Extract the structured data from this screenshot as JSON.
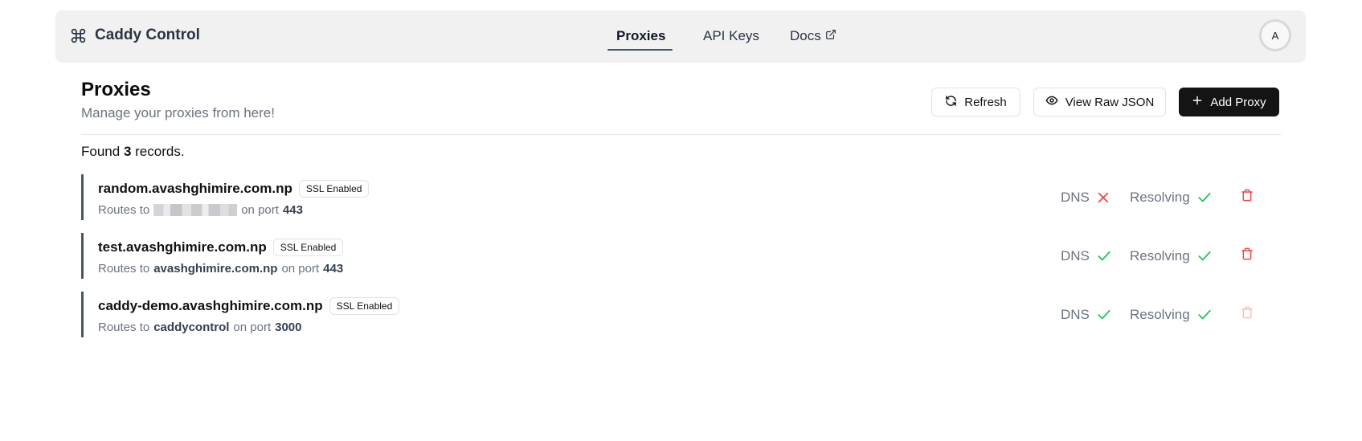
{
  "header": {
    "brand_icon": "command-icon",
    "brand_name": "Caddy Control",
    "tabs": [
      {
        "label": "Proxies",
        "active": true
      },
      {
        "label": "API Keys",
        "active": false
      },
      {
        "label": "Docs",
        "active": false,
        "icon": "external-link-icon"
      }
    ],
    "avatar_initial": "A"
  },
  "page": {
    "title": "Proxies",
    "subtitle": "Manage your proxies from here!"
  },
  "toolbar": {
    "refresh_label": "Refresh",
    "refresh_icon": "refresh-icon",
    "view_raw_label": "View Raw JSON",
    "view_raw_icon": "eye-icon",
    "add_label": "Add Proxy",
    "add_icon": "plus-icon"
  },
  "summary": {
    "prefix": "Found",
    "count": "3",
    "suffix": "records."
  },
  "proxies": [
    {
      "domain": "random.avashghimire.com.np",
      "badge": "SSL Enabled",
      "routes_prefix": "Routes to",
      "target": "",
      "target_redacted": true,
      "port_prefix": "on port",
      "port": "443",
      "dns_label": "DNS",
      "dns_ok": false,
      "resolving_label": "Resolving",
      "resolving_ok": true,
      "delete_enabled": true
    },
    {
      "domain": "test.avashghimire.com.np",
      "badge": "SSL Enabled",
      "routes_prefix": "Routes to",
      "target": "avashghimire.com.np",
      "target_redacted": false,
      "port_prefix": "on port",
      "port": "443",
      "dns_label": "DNS",
      "dns_ok": true,
      "resolving_label": "Resolving",
      "resolving_ok": true,
      "delete_enabled": true
    },
    {
      "domain": "caddy-demo.avashghimire.com.np",
      "badge": "SSL Enabled",
      "routes_prefix": "Routes to",
      "target": "caddycontrol",
      "target_redacted": false,
      "port_prefix": "on port",
      "port": "3000",
      "dns_label": "DNS",
      "dns_ok": true,
      "resolving_label": "Resolving",
      "resolving_ok": true,
      "delete_enabled": false
    }
  ],
  "colors": {
    "ok": "#22c55e",
    "error": "#ef4444",
    "delete": "#ef4444",
    "accent_dark": "#141414"
  }
}
